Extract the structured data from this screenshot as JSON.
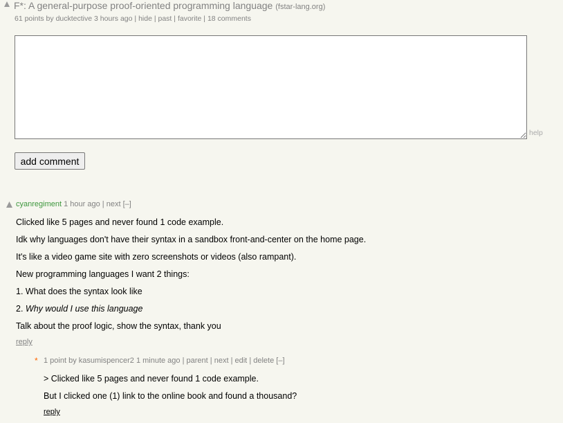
{
  "story": {
    "title": "F*: A general-purpose proof-oriented programming language",
    "site": "(fstar-lang.org)",
    "points": "61 points",
    "by": "by",
    "user": "ducktective",
    "age": "3 hours ago",
    "hide": "hide",
    "past": "past",
    "favorite": "favorite",
    "comments": "18 comments"
  },
  "form": {
    "textarea_value": "",
    "help": "help",
    "add_comment": "add comment"
  },
  "comment1": {
    "user": "cyanregiment",
    "age": "1 hour ago",
    "next": "next",
    "toggle": "[–]",
    "lines": [
      "Clicked like 5 pages and never found 1 code example.",
      "Idk why languages don't have their syntax in a sandbox front-and-center on the home page.",
      "It's like a video game site with zero screenshots or videos (also rampant).",
      "New programming languages I want 2 things:",
      "1. What does the syntax look like",
      "2. ",
      "Talk about the proof logic, show the syntax, thank you"
    ],
    "line6_em": "Why would I use this language",
    "reply": "reply"
  },
  "comment2": {
    "star": "*",
    "points": "1 point",
    "by": "by",
    "user": "kasumispencer2",
    "age": "1 minute ago",
    "parent": "parent",
    "next": "next",
    "edit": "edit",
    "delete": "delete",
    "toggle": "[–]",
    "lines": [
      "> Clicked like 5 pages and never found 1 code example.",
      "But I clicked one (1) link to the online book and found a thousand?"
    ],
    "reply": "reply"
  },
  "colors": {
    "background": "#f6f6ef",
    "muted": "#828282",
    "new_user": "#3c963c",
    "star": "#ff6600"
  }
}
